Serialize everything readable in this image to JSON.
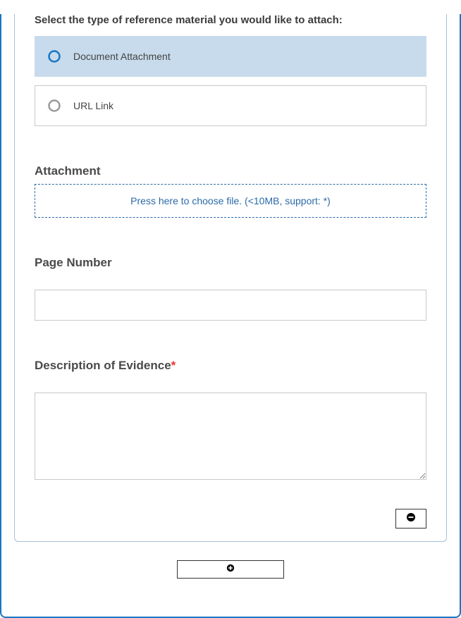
{
  "type_section": {
    "title": "Select the type of reference material you would like to attach:",
    "options": [
      {
        "label": "Document Attachment",
        "selected": true
      },
      {
        "label": "URL Link",
        "selected": false
      }
    ]
  },
  "attachment": {
    "label": "Attachment",
    "dropzone_text": "Press here to choose file. (<10MB, support: *)"
  },
  "page_number": {
    "label": "Page Number",
    "value": ""
  },
  "description": {
    "label": "Description of Evidence",
    "required_mark": "*",
    "value": ""
  }
}
